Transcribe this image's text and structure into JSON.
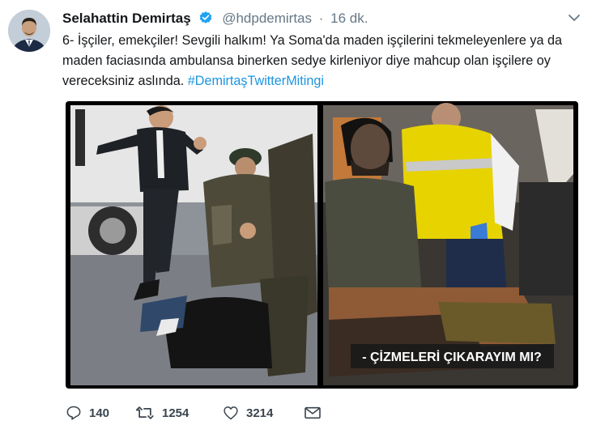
{
  "tweet": {
    "author_name": "Selahattin Demirtaş",
    "author_handle": "@hdpdemirtas",
    "separator": "·",
    "time": "16 dk.",
    "text_main": "6- İşçiler, emekçiler! Sevgili halkım! Ya Soma'da maden işçilerini tekmeleyenlere ya da maden faciasında ambulansa binerken sedye kirleniyor diye mahcup olan işçilere oy vereceksiniz aslında. ",
    "hashtag": "#DemirtaşTwitterMitingi",
    "media_caption": "- ÇİZMELERİ ÇIKARAYIM MI?"
  },
  "actions": {
    "reply_count": "140",
    "retweet_count": "1254",
    "like_count": "3214"
  },
  "icons": {
    "verified": "verified-badge-icon",
    "caret": "chevron-down-icon",
    "reply": "reply-icon",
    "retweet": "retweet-icon",
    "like": "heart-icon",
    "dm": "envelope-icon"
  },
  "colors": {
    "link": "#1b95e0",
    "verified": "#1da1f2",
    "muted": "#657786"
  }
}
